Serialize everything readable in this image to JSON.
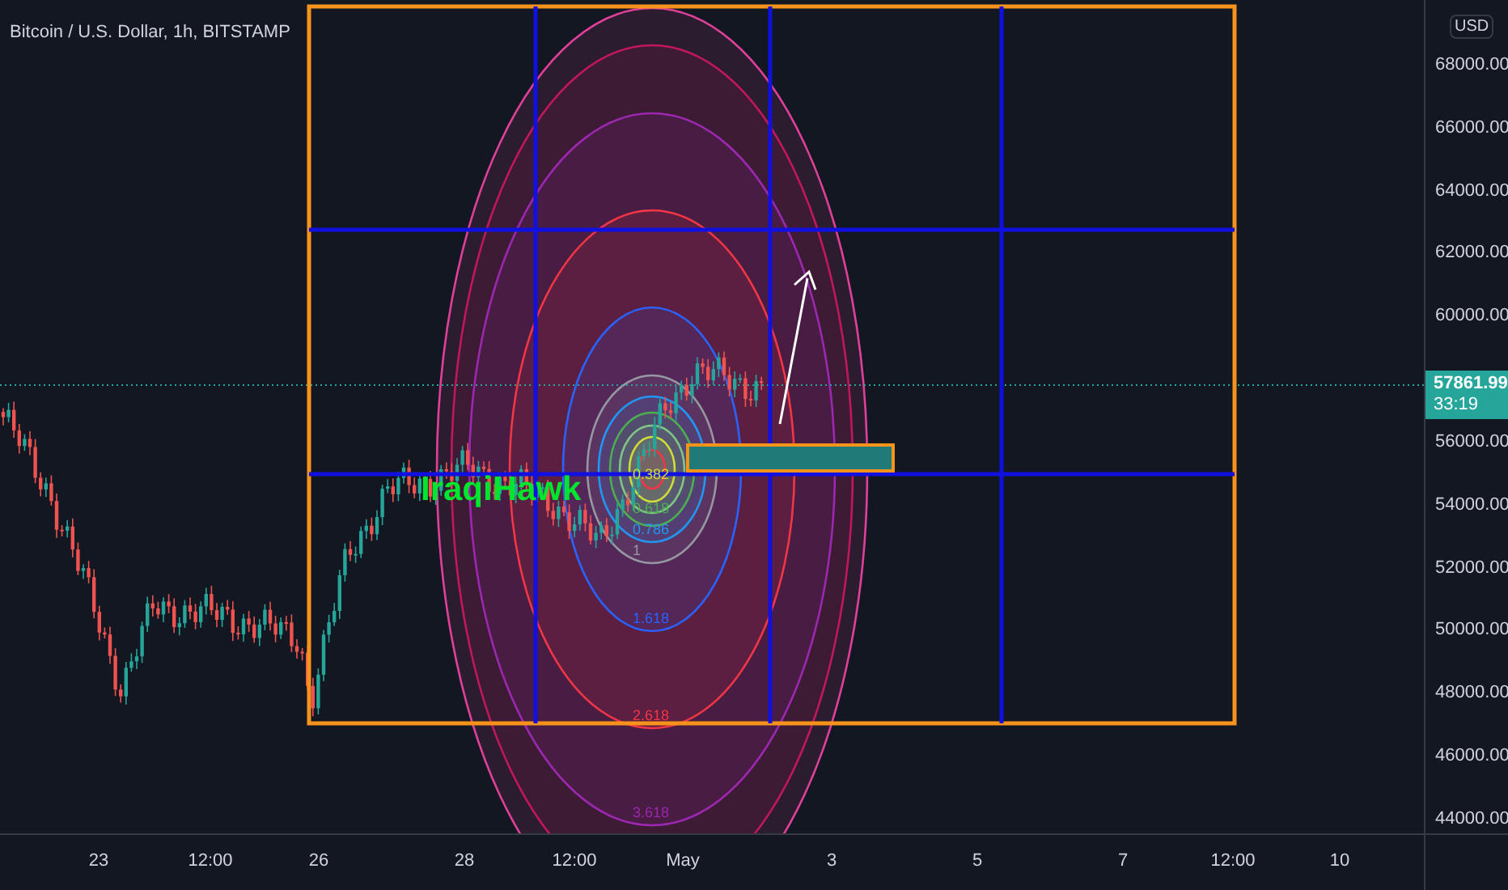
{
  "chart": {
    "title": "Bitcoin / U.S. Dollar, 1h, BITSTAMP",
    "annotation": "IraqiHawk",
    "fib_levels": [
      {
        "label": "0.382",
        "color": "#cddc39"
      },
      {
        "label": "0.618",
        "color": "#4caf50"
      },
      {
        "label": "0.786",
        "color": "#2196f3"
      },
      {
        "label": "1",
        "color": "#9598a1"
      },
      {
        "label": "1.618",
        "color": "#2962ff"
      },
      {
        "label": "2.618",
        "color": "#f23645"
      },
      {
        "label": "3.618",
        "color": "#9c27b0"
      }
    ]
  },
  "price_axis": {
    "currency": "USD",
    "labels": [
      "68000.00",
      "66000.00",
      "64000.00",
      "62000.00",
      "60000.00",
      "56000.00",
      "54000.00",
      "52000.00",
      "50000.00",
      "48000.00",
      "46000.00",
      "44000.00"
    ],
    "last_price": "57861.99",
    "countdown": "33:19"
  },
  "time_axis": {
    "labels": [
      "23",
      "12:00",
      "26",
      "28",
      "12:00",
      "May",
      "3",
      "5",
      "7",
      "12:00",
      "10"
    ]
  }
}
